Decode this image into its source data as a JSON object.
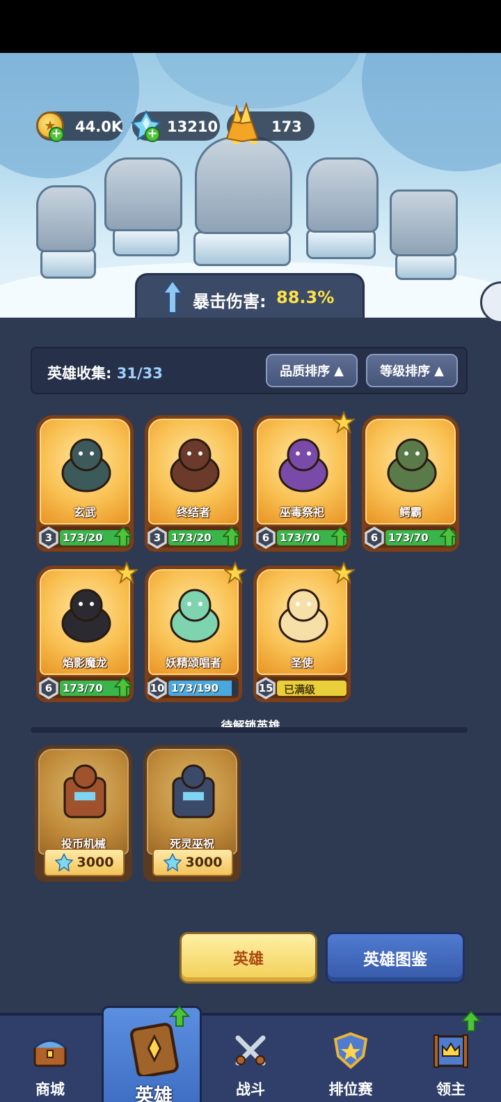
{
  "resources": {
    "gold": "44.0K",
    "crystal": "13210",
    "gem": "173"
  },
  "crit": {
    "label": "暴击伤害:",
    "value": "88.3%"
  },
  "collection": {
    "label": "英雄收集:",
    "value": "31/33",
    "sort_quality": "品质排序",
    "sort_level": "等级排序"
  },
  "heroes": [
    {
      "name": "玄武",
      "level": "3",
      "progress_text": "173/20",
      "progress": 1.0,
      "starred": false,
      "upgradable": true
    },
    {
      "name": "终结者",
      "level": "3",
      "progress_text": "173/20",
      "progress": 1.0,
      "starred": false,
      "upgradable": true
    },
    {
      "name": "巫毒祭祀",
      "level": "6",
      "progress_text": "173/70",
      "progress": 1.0,
      "starred": true,
      "upgradable": true
    },
    {
      "name": "鳄霸",
      "level": "6",
      "progress_text": "173/70",
      "progress": 1.0,
      "starred": false,
      "upgradable": true
    },
    {
      "name": "焰影魔龙",
      "level": "6",
      "progress_text": "173/70",
      "progress": 1.0,
      "starred": true,
      "upgradable": true
    },
    {
      "name": "妖精颂唱者",
      "level": "10",
      "progress_text": "173/190",
      "progress": 0.91,
      "starred": true,
      "upgradable": false
    },
    {
      "name": "圣使",
      "level": "15",
      "progress_text": "已满级",
      "progress": 1.0,
      "starred": true,
      "upgradable": false
    }
  ],
  "locked_section": {
    "label": "待解锁英雄",
    "heroes": [
      {
        "name": "投币机械",
        "price": "3000"
      },
      {
        "name": "死灵巫祝",
        "price": "3000"
      }
    ]
  },
  "buttons": {
    "hero": "英雄",
    "codex": "英雄图鉴"
  },
  "nav": [
    {
      "label": "商城",
      "icon": "chest-icon"
    },
    {
      "label": "英雄",
      "icon": "hero-card-icon"
    },
    {
      "label": "战斗",
      "icon": "crossed-swords-icon"
    },
    {
      "label": "排位赛",
      "icon": "rank-shield-icon"
    },
    {
      "label": "领主",
      "icon": "castle-banner-icon"
    }
  ],
  "colors": {
    "background": "#2e3a52",
    "crit_value": "#ffe24a",
    "upgrade_green": "#39b54a",
    "nav_active": "#4f82d6"
  }
}
